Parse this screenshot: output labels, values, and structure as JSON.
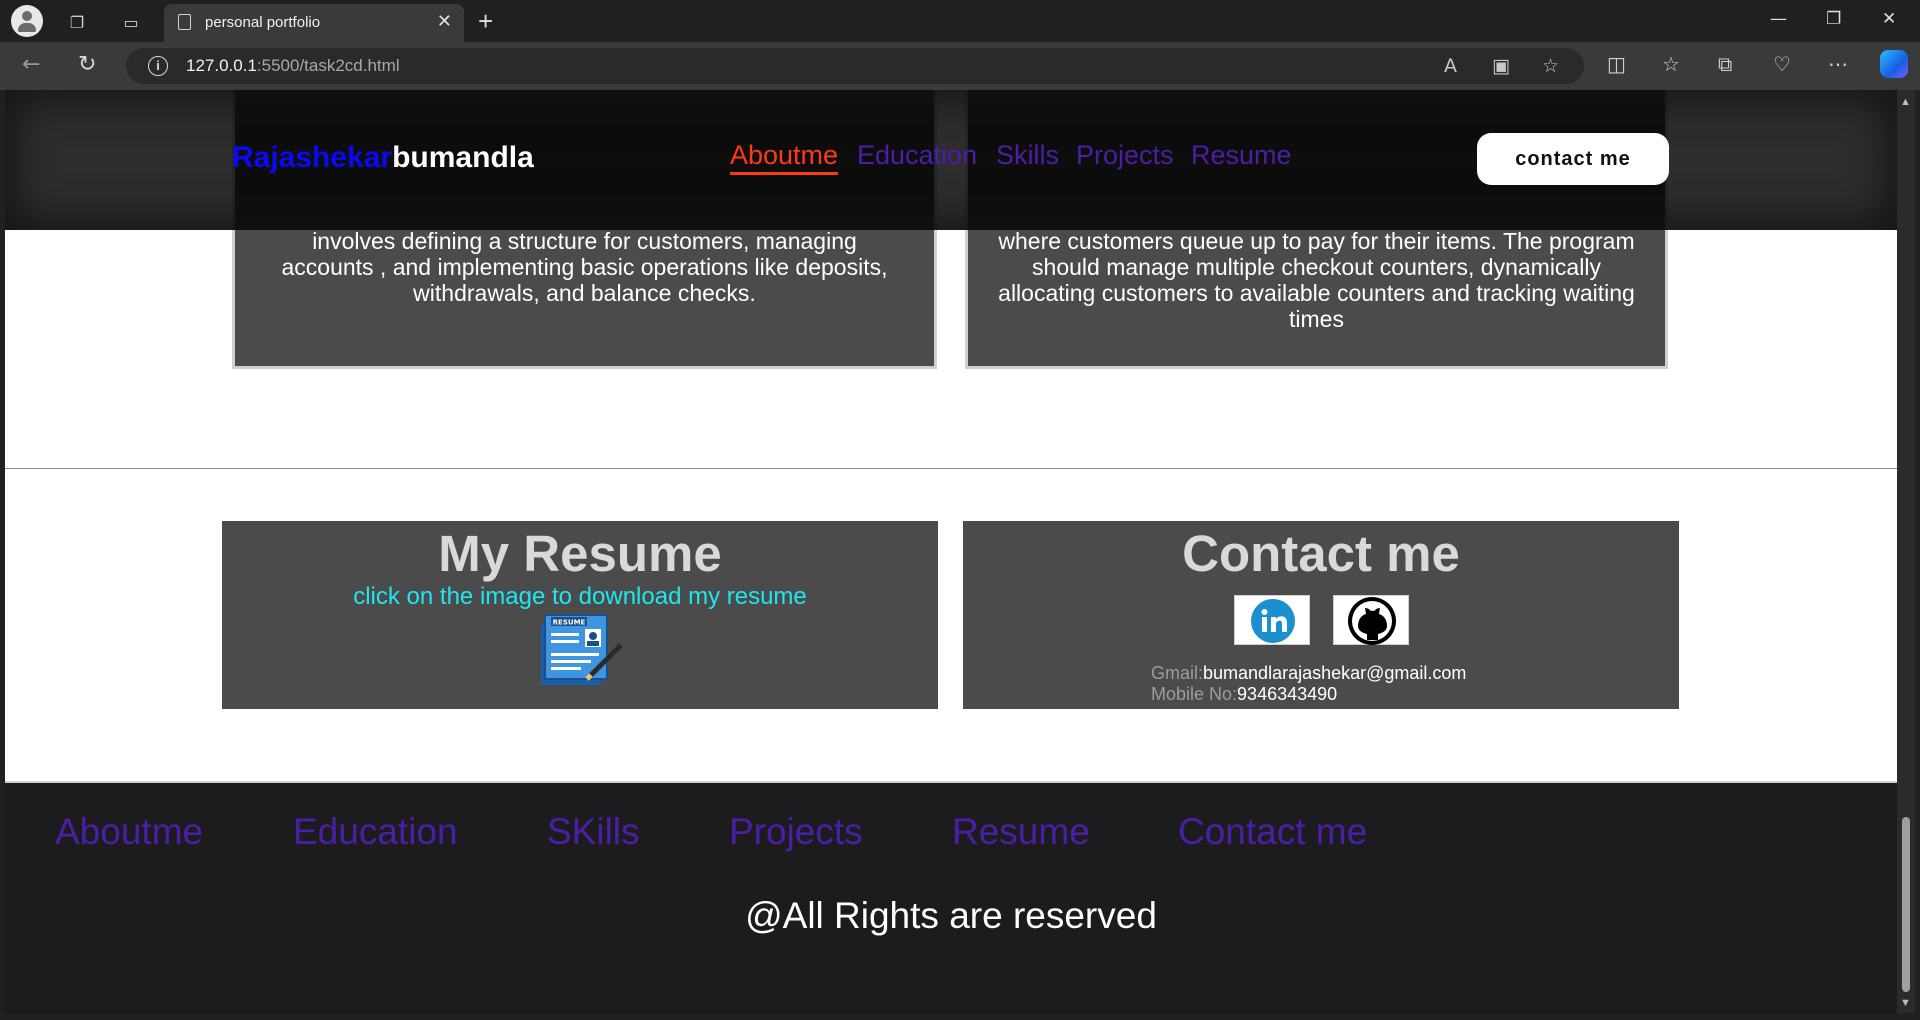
{
  "browser": {
    "tab_title": "personal portfolio",
    "url_host": "127.0.0.1",
    "url_rest": ":5500/task2cd.html"
  },
  "header": {
    "logo_first": "Rajashekar",
    "logo_last": "bumandla",
    "nav": [
      "Aboutme",
      "Education",
      "Skills",
      "Projects",
      "Resume"
    ],
    "active_nav": "Aboutme",
    "contact_button": "contact me"
  },
  "projects": {
    "p1_text": "involves defining a structure for customers, managing accounts , and implementing basic operations like deposits, withdrawals, and balance checks.",
    "p2_text": "where customers queue up to pay for their items. The program should manage multiple checkout counters, dynamically allocating customers to available counters and tracking waiting times"
  },
  "resume": {
    "title": "My Resume",
    "subtitle": "click on the image to download my resume"
  },
  "contact": {
    "title": "Contact me",
    "gmail_label": "Gmail:",
    "gmail_value": "bumandlarajashekar@gmail.com",
    "mobile_label": "Mobile No:",
    "mobile_value": "9346343490"
  },
  "footer": {
    "nav": [
      "Aboutme",
      "Education",
      "SKills",
      "Projects",
      "Resume",
      "Contact me"
    ],
    "copyright": "@All Rights are reserved"
  },
  "colors": {
    "nav_purple": "#4b1ea8",
    "active_orange": "#ff3a10",
    "logo_blue": "#0a0af2",
    "cyan_text": "#1ee7ee",
    "panel_grey": "#4b4b4b"
  }
}
